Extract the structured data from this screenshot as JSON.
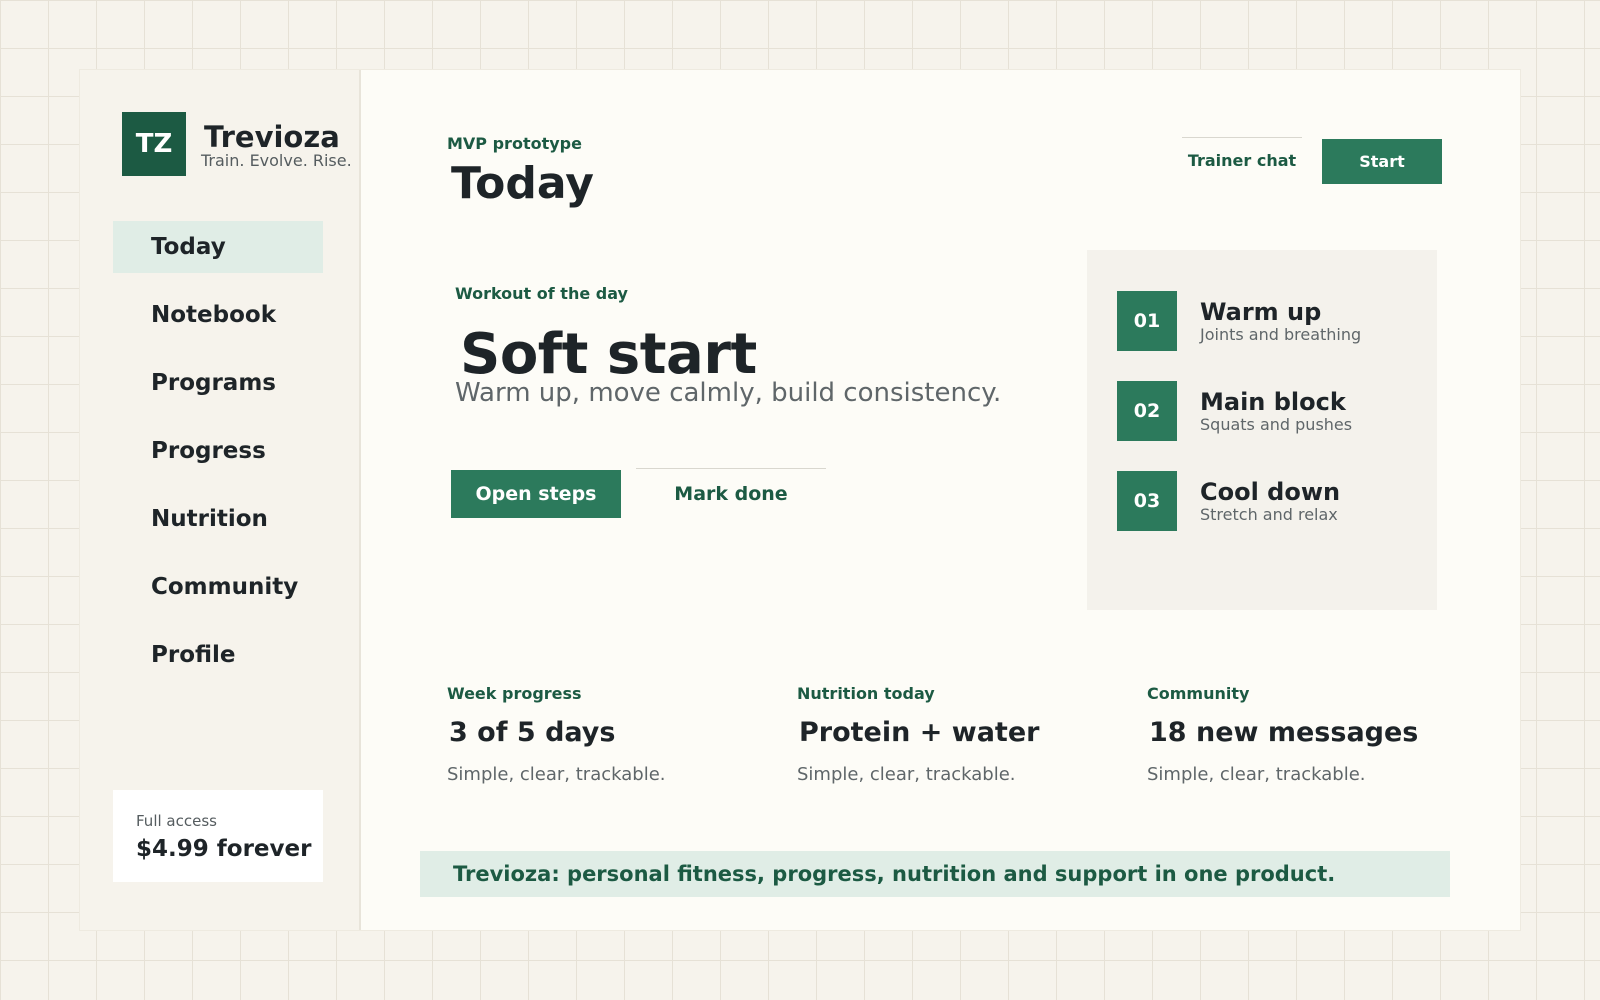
{
  "brand": {
    "logo": "TZ",
    "name": "Trevioza",
    "tagline": "Train. Evolve. Rise."
  },
  "nav": {
    "items": [
      {
        "label": "Today",
        "active": true
      },
      {
        "label": "Notebook"
      },
      {
        "label": "Programs"
      },
      {
        "label": "Progress"
      },
      {
        "label": "Nutrition"
      },
      {
        "label": "Community"
      },
      {
        "label": "Profile"
      }
    ]
  },
  "pricing": {
    "label": "Full access",
    "value": "$4.99 forever"
  },
  "header": {
    "eyebrow": "MVP prototype",
    "title": "Today",
    "trainer_chat_label": "Trainer chat",
    "start_label": "Start"
  },
  "workout": {
    "eyebrow": "Workout of the day",
    "title": "Soft start",
    "subtitle": "Warm up, move calmly, build consistency.",
    "open_steps_label": "Open steps",
    "mark_done_label": "Mark done"
  },
  "steps": [
    {
      "num": "01",
      "title": "Warm up",
      "desc": "Joints and breathing"
    },
    {
      "num": "02",
      "title": "Main block",
      "desc": "Squats and pushes"
    },
    {
      "num": "03",
      "title": "Cool down",
      "desc": "Stretch and relax"
    }
  ],
  "stats": [
    {
      "label": "Week progress",
      "value": "3 of 5 days",
      "desc": "Simple, clear, trackable."
    },
    {
      "label": "Nutrition today",
      "value": "Protein + water",
      "desc": "Simple, clear, trackable."
    },
    {
      "label": "Community",
      "value": "18 new messages",
      "desc": "Simple, clear, trackable."
    }
  ],
  "banner": {
    "text": "Trevioza: personal fitness, progress, nutrition and support in one product."
  },
  "colors": {
    "accent": "#2c7a5c",
    "brand_dark": "#1c5a43",
    "highlight": "#e0ede6"
  }
}
